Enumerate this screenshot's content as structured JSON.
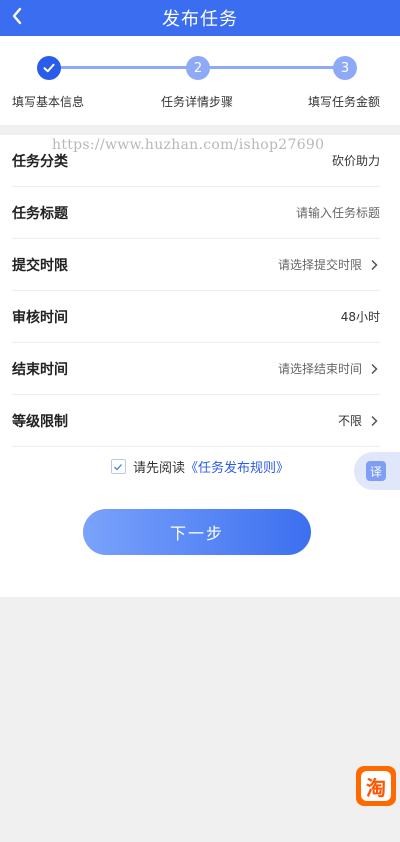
{
  "header": {
    "title": "发布任务",
    "back_icon": "chevron-left-icon"
  },
  "steps": [
    {
      "number": "",
      "label": "填写基本信息",
      "state": "completed",
      "icon": "check-icon"
    },
    {
      "number": "2",
      "label": "任务详情步骤",
      "state": "pending"
    },
    {
      "number": "3",
      "label": "填写任务金额",
      "state": "pending"
    }
  ],
  "watermark": "https://www.huzhan.com/ishop27690",
  "form": {
    "rows": [
      {
        "label": "任务分类",
        "value": "砍价助力",
        "is_placeholder": false,
        "chevron": false
      },
      {
        "label": "任务标题",
        "value": "请输入任务标题",
        "is_placeholder": true,
        "chevron": false
      },
      {
        "label": "提交时限",
        "value": "请选择提交时限",
        "is_placeholder": true,
        "chevron": true
      },
      {
        "label": "审核时间",
        "value": "48小时",
        "is_placeholder": false,
        "chevron": false
      },
      {
        "label": "结束时间",
        "value": "请选择结束时间",
        "is_placeholder": true,
        "chevron": true
      },
      {
        "label": "等级限制",
        "value": "不限",
        "is_placeholder": false,
        "chevron": true
      }
    ]
  },
  "agreement": {
    "checked": true,
    "prefix": "请先阅读",
    "link": "《任务发布规则》"
  },
  "next_button": "下一步",
  "floating": {
    "translate_label": "译",
    "taobao_label": "淘"
  },
  "colors": {
    "primary": "#3b6df0",
    "step_active": "#2a5cea",
    "step_inactive": "#8eaaf6",
    "link": "#2a5cea"
  }
}
